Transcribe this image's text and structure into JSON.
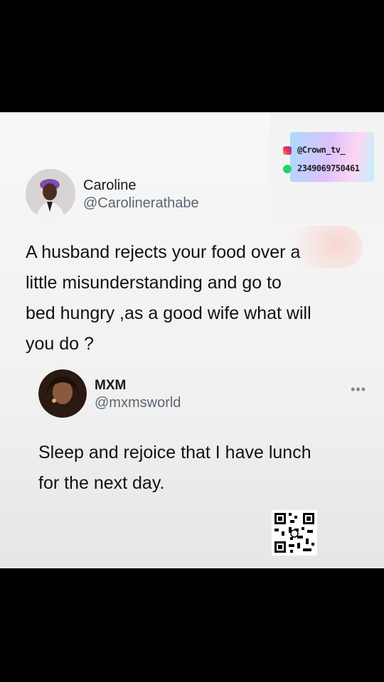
{
  "tweet": {
    "author_name": "Caroline",
    "author_handle": "@Carolinerathabe",
    "text_lines": [
      "A husband rejects your food over a",
      "little misunderstanding and go to",
      "bed hungry ,as a good wife what will",
      "you do ?"
    ]
  },
  "reply": {
    "author_name": "MXM",
    "author_handle": "@mxmsworld",
    "text_lines": [
      "Sleep and rejoice that I have lunch",
      "for the next day."
    ],
    "more_label": "•••"
  },
  "watermark": {
    "instagram": "@Crown_tv_",
    "whatsapp": "2349069750461",
    "instagram_icon": "instagram-icon",
    "whatsapp_icon": "whatsapp-icon"
  },
  "qr_code": {
    "icon": "qr-code-icon"
  },
  "colors": {
    "background": "#000000",
    "card": "#f4f4f4",
    "handle": "#5b6670"
  }
}
